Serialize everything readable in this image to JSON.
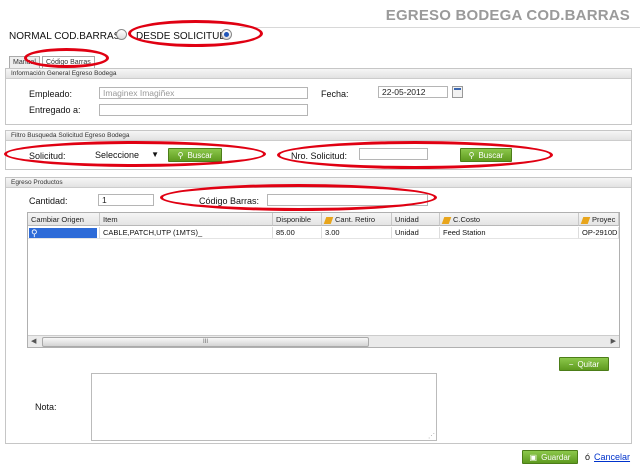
{
  "header": {
    "title": "EGRESO BODEGA COD.BARRAS"
  },
  "mode_radios": [
    {
      "label": "NORMAL COD.BARRAS",
      "selected": false
    },
    {
      "label": "DESDE SOLICITUD",
      "selected": true
    }
  ],
  "tabs": [
    {
      "label": "Manual",
      "active": false
    },
    {
      "label": "Código Barras",
      "active": true
    }
  ],
  "info_section": {
    "title": "Información General Egreso Bodega",
    "empleado_label": "Empleado:",
    "empleado_placeholder": "Imaginex Imagiñex",
    "fecha_label": "Fecha:",
    "fecha_value": "22-05-2012",
    "entregado_label": "Entregado a:",
    "entregado_value": ""
  },
  "filter_section": {
    "title": "Filtro Busqueda Solicitud Egreso Bodega",
    "solicitud_label": "Solicitud:",
    "solicitud_selected": "Seleccione",
    "buscar_label": "Buscar",
    "nro_label": "Nro. Solicitud:",
    "nro_value": "",
    "buscar2_label": "Buscar"
  },
  "products_section": {
    "title": "Egreso Productos",
    "cantidad_label": "Cantidad:",
    "cantidad_value": "1",
    "codigo_label": "Código Barras:",
    "codigo_value": ""
  },
  "grid": {
    "columns": [
      "Cambiar Origen",
      "Item",
      "Disponible",
      "Cant. Retiro",
      "Unidad",
      "C.Costo",
      "Proyec"
    ],
    "rows": [
      {
        "cambiar_origen": "",
        "item": "CABLE,PATCH,UTP (1MTS)_",
        "disponible": "85.00",
        "cant_retiro": "3.00",
        "unidad": "Unidad",
        "ccosto": "Feed Station",
        "proyecto": "OP-2910D"
      }
    ],
    "scroll_left": "◀",
    "scroll_thumb": "III",
    "scroll_right": "▶"
  },
  "quitar_label": "Quitar",
  "nota_label": "Nota:",
  "nota_value": "",
  "footer": {
    "guardar_label": "Guardar",
    "or_text": "ó",
    "cancelar_label": "Cancelar"
  },
  "colors": {
    "accent_green": "#6aa82a",
    "annotation_red": "#e00012",
    "link_blue": "#0033cc"
  }
}
